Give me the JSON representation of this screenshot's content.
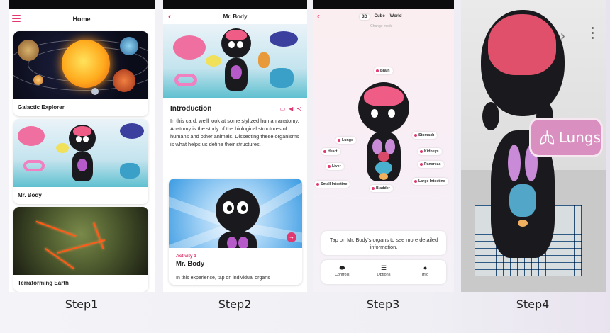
{
  "steps": {
    "s1": "Step1",
    "s2": "Step2",
    "s3": "Step3",
    "s4": "Step4"
  },
  "step1": {
    "title": "Home",
    "cards": [
      "Galactic Explorer",
      "Mr. Body",
      "Terraforming Earth"
    ]
  },
  "step2": {
    "title": "Mr. Body",
    "intro_title": "Introduction",
    "intro_text": "In this card, we'll look at some stylized human anatomy. Anatomy is the study of the biological structures of humans and other animals. Dissecting these organisms is what helps us define their structures.",
    "activity_kicker": "Activity 1",
    "activity_title": "Mr. Body",
    "activity_text": "In this experience, tap on individual organs"
  },
  "step3": {
    "modes": [
      "3D",
      "Cube",
      "World"
    ],
    "active_mode": "3D",
    "change_mode": "Change mode",
    "organs": {
      "brain": "Brain",
      "stomach": "Stomach",
      "lungs": "Lungs",
      "heart": "Heart",
      "kidneys": "Kidneys",
      "pancreas": "Pancreas",
      "liver": "Liver",
      "small_intestine": "Small Intestine",
      "large_intestine": "Large Intestine",
      "bladder": "Bladder"
    },
    "hint": "Tap on Mr. Body's organs to see more detailed information.",
    "tabs": {
      "controls": "Controls",
      "options": "Options",
      "info": "Info"
    }
  },
  "step4": {
    "label": "Lungs"
  },
  "colors": {
    "accent": "#e2386f",
    "lungs_pill": "#d98fc0"
  }
}
